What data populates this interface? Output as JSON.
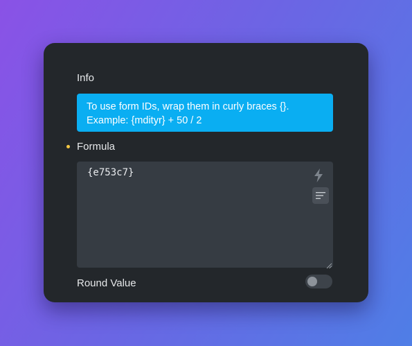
{
  "info": {
    "label": "Info",
    "line1": "To use form IDs, wrap them in curly braces {}.",
    "line2": "Example: {mdityr} + 50 / 2"
  },
  "formula": {
    "label": "Formula",
    "value": "{e753c7}",
    "required_dot_color": "#f5c842"
  },
  "default_value": {
    "label": "Round Value",
    "toggle_on": false
  },
  "icons": {
    "insert": "lightning-bolt-icon",
    "format": "text-lines-icon",
    "resize": "resize-grip-icon"
  },
  "colors": {
    "info_background": "#0aaef2",
    "panel_background": "#23272b",
    "editor_background": "#363c43"
  }
}
